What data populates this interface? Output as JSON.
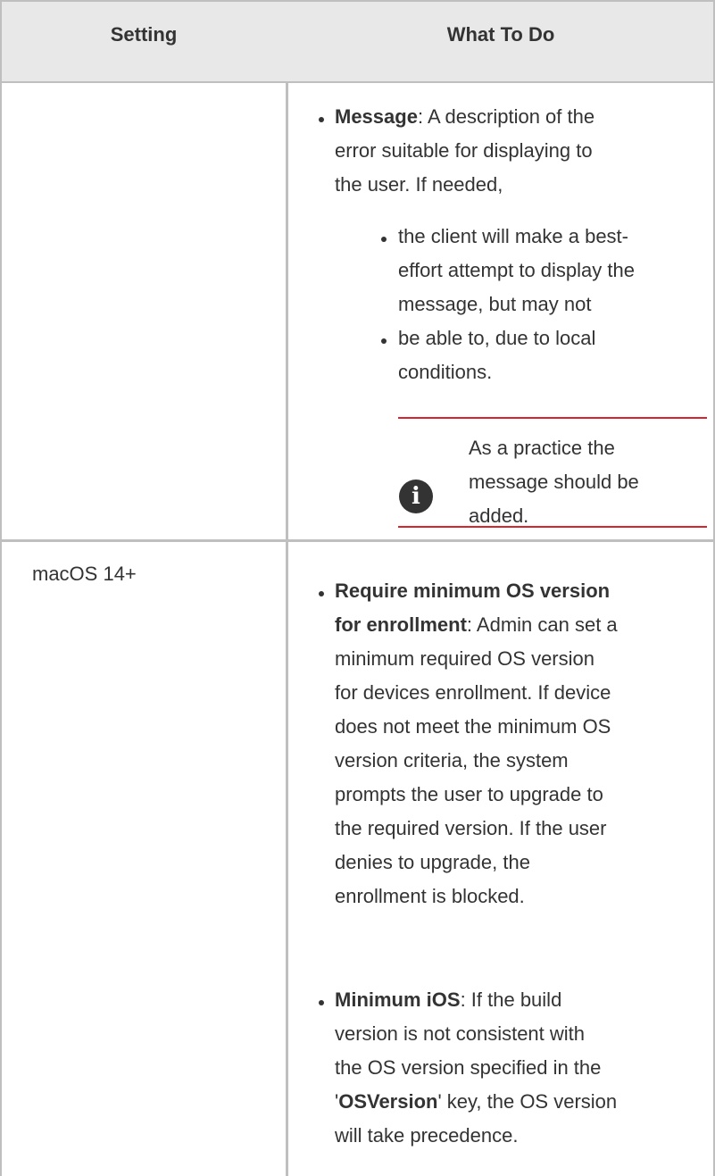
{
  "table": {
    "headers": [
      "Setting",
      "What To Do"
    ],
    "row1": {
      "setting": "",
      "message_term": "Message",
      "message_lines": [
        ": A description of the",
        "error suitable for displaying to",
        "the user. If needed,"
      ],
      "sub1_lines": [
        "the client will make a best-",
        "effort attempt to display the",
        "message, but may not"
      ],
      "sub2_lines": [
        "be able to, due to local",
        "conditions."
      ],
      "note_lines": [
        "As a practice the",
        "message should be",
        "added."
      ]
    },
    "row2": {
      "setting": "macOS 14+",
      "b1_term_lines": [
        "Require minimum OS version",
        "for enrollment"
      ],
      "b1_lines": [
        ": Admin can set a",
        "minimum required OS version",
        "for devices enrollment. If device",
        "does not meet the minimum OS",
        "version criteria, the system",
        "prompts the user to upgrade to",
        "the required version. If the user",
        "denies to upgrade, the",
        "enrollment is blocked."
      ],
      "b2_term": "Minimum iOS",
      "b2_lines": [
        ": If the build",
        "version is not consistent with",
        "the OS version specified in the"
      ],
      "b2_quote_open": "'",
      "b2_key": "OSVersion",
      "b2_quote_close": "' key, the OS version",
      "b2_last": "will take precedence."
    }
  },
  "icons": {
    "note": "info-icon"
  },
  "colors": {
    "header_bg": "#e8e8e8",
    "rule_red": "#d9232d",
    "border": "#bfbfbf"
  }
}
